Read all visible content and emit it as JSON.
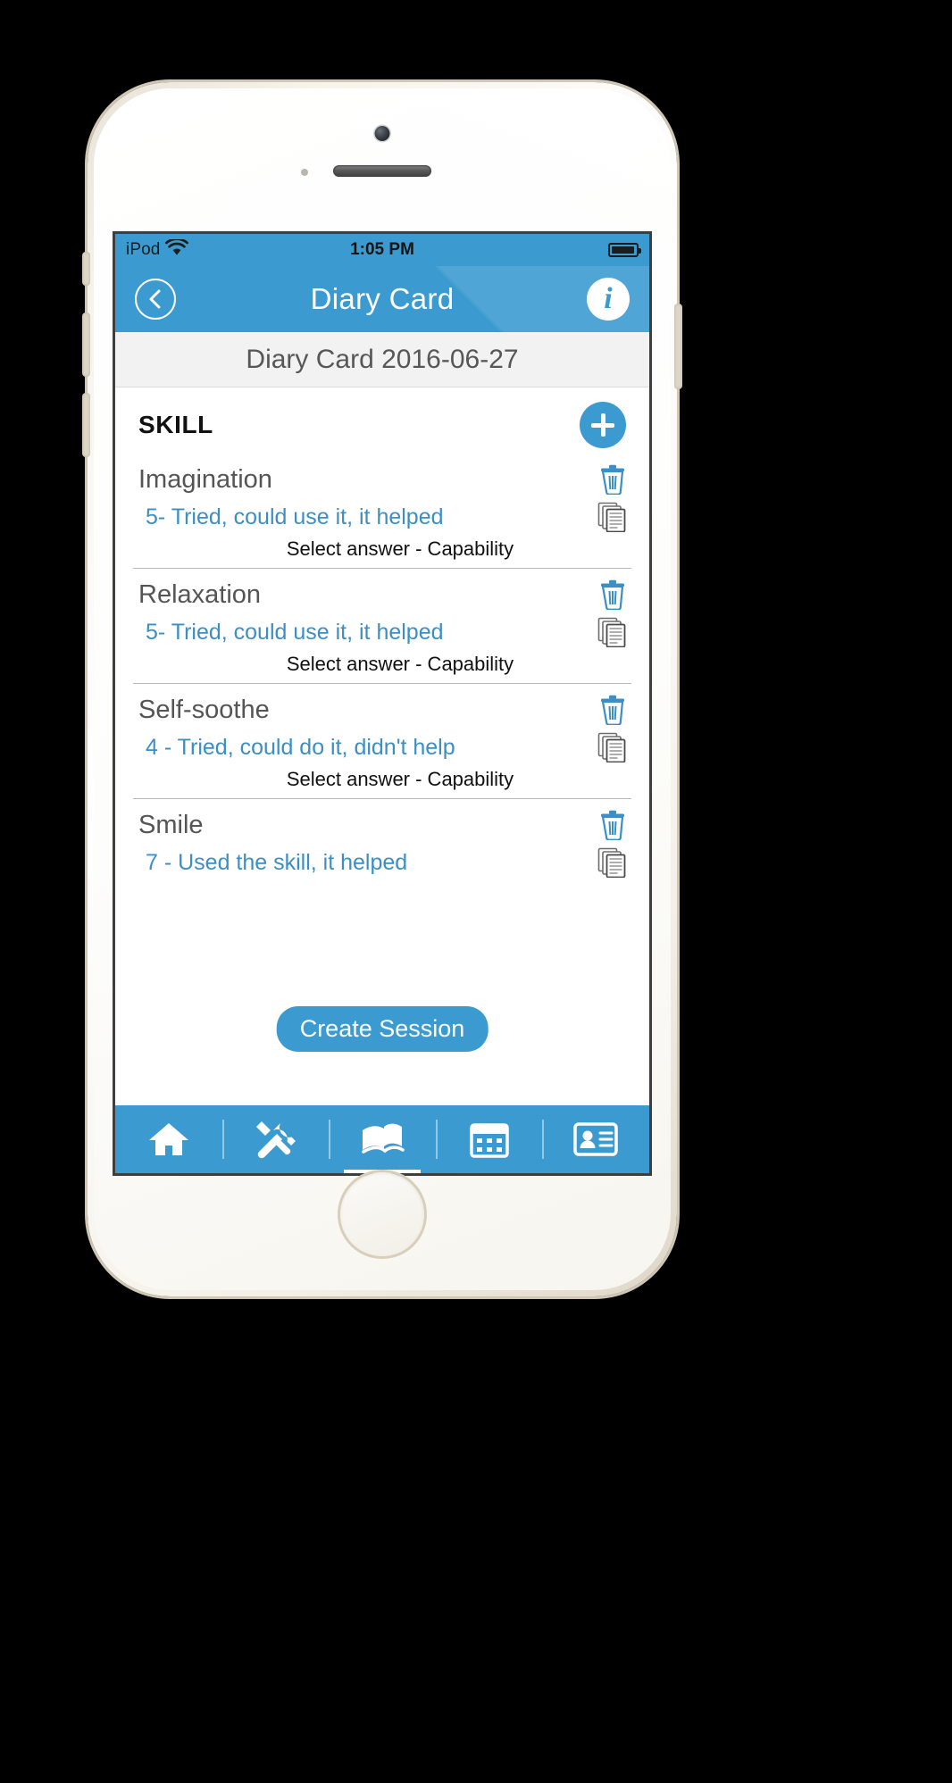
{
  "device": {
    "type": "iPod touch",
    "status_bar": {
      "carrier": "iPod",
      "wifi_icon": "wifi-icon",
      "time": "1:05 PM",
      "battery_icon": "battery-full-icon",
      "battery_level": 95
    }
  },
  "navbar": {
    "back_icon": "chevron-left-circle-icon",
    "title": "Diary Card",
    "info_icon": "info-circle-icon",
    "info_label": "i"
  },
  "subheader": {
    "title": "Diary Card 2016-06-27"
  },
  "section": {
    "header_label": "SKILL",
    "add_icon": "plus-circle-icon"
  },
  "entries": [
    {
      "name": "Imagination",
      "answer": "5- Tried, could use it, it helped",
      "caption": "Select answer - Capability",
      "delete_icon": "trash-icon",
      "copy_icon": "copy-pages-icon"
    },
    {
      "name": "Relaxation",
      "answer": "5- Tried, could use it, it helped",
      "caption": "Select answer - Capability",
      "delete_icon": "trash-icon",
      "copy_icon": "copy-pages-icon"
    },
    {
      "name": "Self-soothe",
      "answer": "4 - Tried, could do it, didn't help",
      "caption": "Select answer - Capability",
      "delete_icon": "trash-icon",
      "copy_icon": "copy-pages-icon"
    },
    {
      "name": "Smile",
      "answer": "7 - Used the skill, it helped",
      "caption": "",
      "delete_icon": "trash-icon",
      "copy_icon": "copy-pages-icon"
    }
  ],
  "floating_action": {
    "label": "Create Session"
  },
  "tabbar": {
    "items": [
      {
        "name": "home",
        "icon": "home-icon",
        "active": false
      },
      {
        "name": "tools",
        "icon": "tools-icon",
        "active": false
      },
      {
        "name": "diary",
        "icon": "book-icon",
        "active": true
      },
      {
        "name": "calendar",
        "icon": "calendar-icon",
        "active": false
      },
      {
        "name": "contact",
        "icon": "id-card-icon",
        "active": false
      }
    ]
  },
  "colors": {
    "accent": "#3b9bd1",
    "answer_text": "#3b8fc4",
    "subheader_bg": "#f2f2f2",
    "entry_name": "#555555"
  }
}
